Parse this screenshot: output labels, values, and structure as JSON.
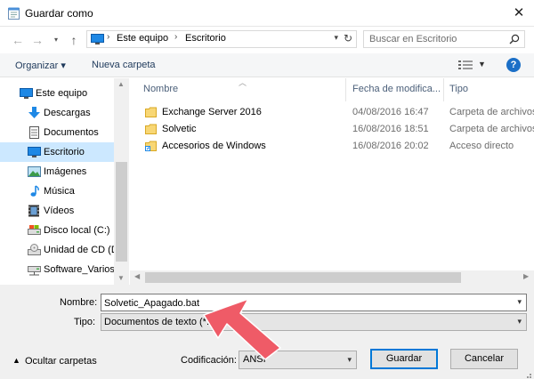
{
  "window": {
    "title": "Guardar como",
    "close_glyph": "✕"
  },
  "address": {
    "crumbs": [
      "Este equipo",
      "Escritorio"
    ],
    "separator": "›"
  },
  "search": {
    "placeholder": "Buscar en Escritorio"
  },
  "toolbar": {
    "organize_label": "Organizar ▾",
    "new_folder_label": "Nueva carpeta"
  },
  "sidebar": {
    "items": [
      {
        "label": "Este equipo",
        "icon": "computer-icon",
        "selected": false
      },
      {
        "label": "Descargas",
        "icon": "download-icon",
        "selected": false
      },
      {
        "label": "Documentos",
        "icon": "document-icon",
        "selected": false
      },
      {
        "label": "Escritorio",
        "icon": "desktop-icon",
        "selected": true
      },
      {
        "label": "Imágenes",
        "icon": "pictures-icon",
        "selected": false
      },
      {
        "label": "Música",
        "icon": "music-icon",
        "selected": false
      },
      {
        "label": "Vídeos",
        "icon": "video-icon",
        "selected": false
      },
      {
        "label": "Disco local (C:)",
        "icon": "disk-icon",
        "selected": false
      },
      {
        "label": "Unidad de CD (D",
        "icon": "cd-icon",
        "selected": false
      },
      {
        "label": "Software_Varios",
        "icon": "network-drive-icon",
        "selected": false
      }
    ]
  },
  "filelist": {
    "columns": [
      "Nombre",
      "Fecha de modifica...",
      "Tipo"
    ],
    "rows": [
      {
        "name": "Exchange Server 2016",
        "date": "04/08/2016 16:47",
        "type": "Carpeta de archivos",
        "icon": "folder-icon"
      },
      {
        "name": "Solvetic",
        "date": "16/08/2016 18:51",
        "type": "Carpeta de archivos",
        "icon": "folder-icon"
      },
      {
        "name": "Accesorios de Windows",
        "date": "16/08/2016 20:02",
        "type": "Acceso directo",
        "icon": "shortcut-icon"
      }
    ]
  },
  "form": {
    "name_label": "Nombre:",
    "name_value": "Solvetic_Apagado.bat",
    "type_label": "Tipo:",
    "type_value": "Documentos de texto (*.txt)",
    "encoding_label": "Codificación:",
    "encoding_value": "ANSI",
    "hide_folders_label": "Ocultar carpetas",
    "save_label": "Guardar",
    "cancel_label": "Cancelar"
  },
  "colors": {
    "selection": "#cce8ff",
    "accent": "#0078d7",
    "annotation_arrow": "#ef5b67"
  }
}
